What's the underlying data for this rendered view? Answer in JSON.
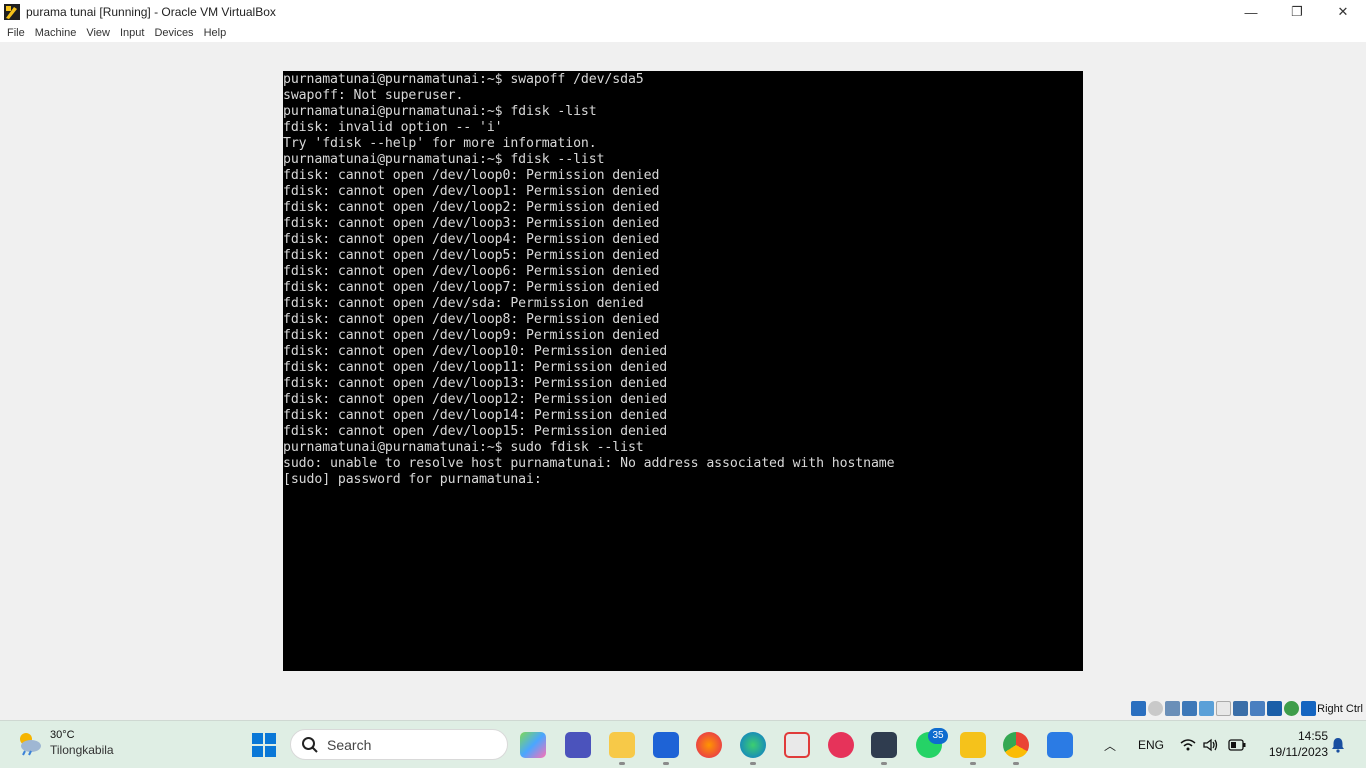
{
  "window": {
    "title": "purama tunai [Running] - Oracle VM VirtualBox",
    "minimize_glyph": "—",
    "restore_glyph": "❐",
    "close_glyph": "✕"
  },
  "menu": [
    "File",
    "Machine",
    "View",
    "Input",
    "Devices",
    "Help"
  ],
  "terminal": {
    "lines": [
      "purnamatunai@purnamatunai:~$ swapoff /dev/sda5",
      "swapoff: Not superuser.",
      "purnamatunai@purnamatunai:~$ fdisk -list",
      "fdisk: invalid option -- 'i'",
      "Try 'fdisk --help' for more information.",
      "purnamatunai@purnamatunai:~$ fdisk --list",
      "fdisk: cannot open /dev/loop0: Permission denied",
      "fdisk: cannot open /dev/loop1: Permission denied",
      "fdisk: cannot open /dev/loop2: Permission denied",
      "fdisk: cannot open /dev/loop3: Permission denied",
      "fdisk: cannot open /dev/loop4: Permission denied",
      "fdisk: cannot open /dev/loop5: Permission denied",
      "fdisk: cannot open /dev/loop6: Permission denied",
      "fdisk: cannot open /dev/loop7: Permission denied",
      "fdisk: cannot open /dev/sda: Permission denied",
      "fdisk: cannot open /dev/loop8: Permission denied",
      "fdisk: cannot open /dev/loop9: Permission denied",
      "fdisk: cannot open /dev/loop10: Permission denied",
      "fdisk: cannot open /dev/loop11: Permission denied",
      "fdisk: cannot open /dev/loop13: Permission denied",
      "fdisk: cannot open /dev/loop12: Permission denied",
      "fdisk: cannot open /dev/loop14: Permission denied",
      "fdisk: cannot open /dev/loop15: Permission denied",
      "purnamatunai@purnamatunai:~$ sudo fdisk --list",
      "sudo: unable to resolve host purnamatunai: No address associated with hostname",
      "[sudo] password for purnamatunai: "
    ]
  },
  "status_bar": {
    "host_key": "Right Ctrl"
  },
  "taskbar": {
    "weather": {
      "temperature": "30°C",
      "location": "Tilongkabila"
    },
    "search_label": "Search",
    "whatsapp_badge": "35",
    "language": "ENG",
    "time": "14:55",
    "date": "19/11/2023"
  }
}
